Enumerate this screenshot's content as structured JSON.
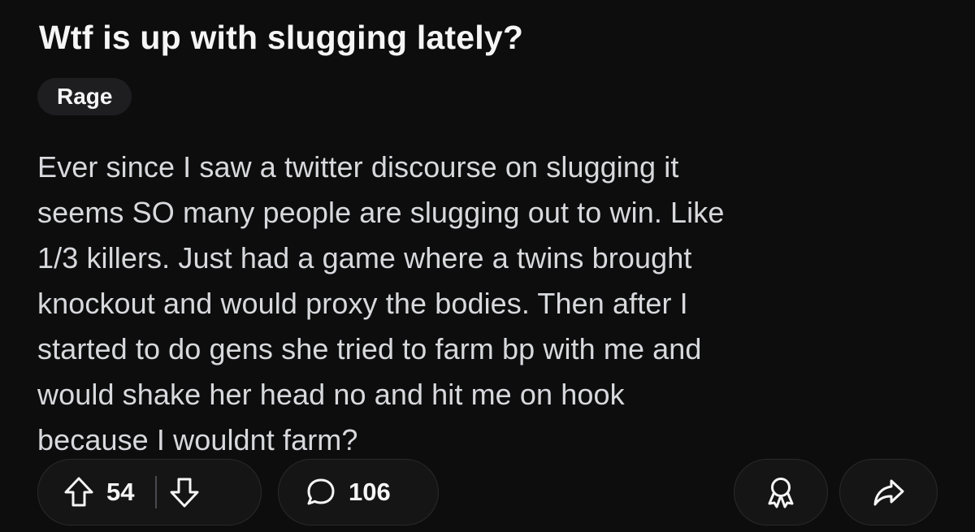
{
  "post": {
    "title": "Wtf is up with slugging lately?",
    "flair": "Rage",
    "body_lines": [
      "Ever since I saw a twitter discourse on slugging it",
      "seems SO many people are slugging out to win. Like",
      "1/3 killers. Just had a game where a twins brought",
      "knockout and would proxy the bodies. Then after I",
      "started to do gens she tried to farm bp with me and",
      "would shake her head no and hit me on hook",
      "because I wouldnt farm?"
    ]
  },
  "actions": {
    "upvote_icon": "arrow-up-icon",
    "downvote_icon": "arrow-down-icon",
    "vote_count": "54",
    "comment_icon": "speech-bubble-icon",
    "comment_count": "106",
    "award_icon": "award-ribbon-icon",
    "share_icon": "share-arrow-icon"
  },
  "colors": {
    "background": "#0d0d0e",
    "pill_background": "#151516",
    "text_primary": "#f5f5f5",
    "text_body": "#d8d9dc"
  }
}
